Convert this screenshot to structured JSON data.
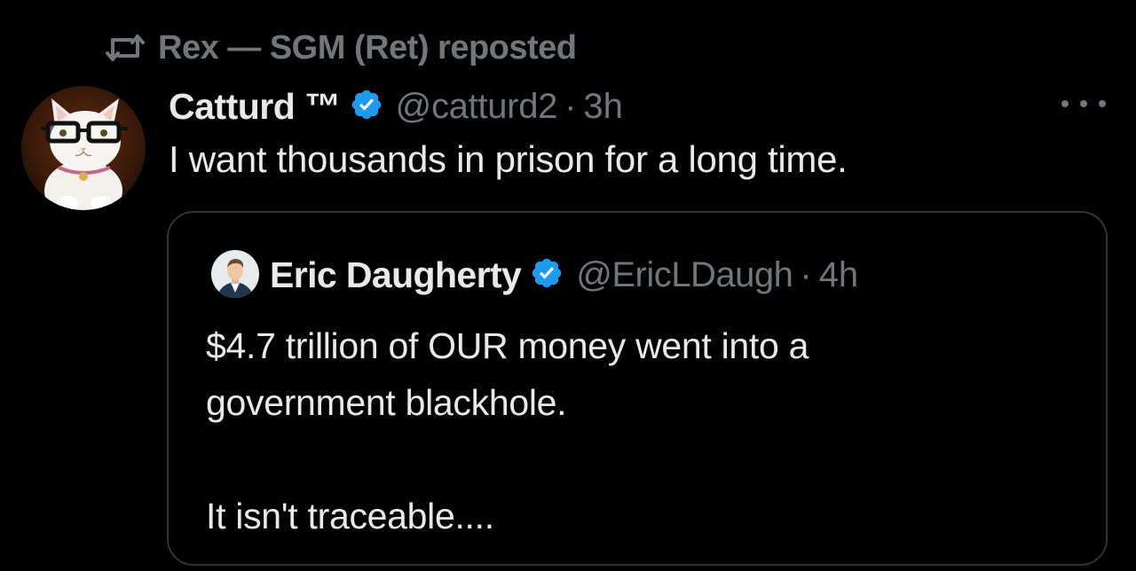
{
  "repost": {
    "text": "Rex — SGM (Ret) reposted",
    "icon": "repost-icon"
  },
  "tweet": {
    "author_name": "Catturd ™",
    "handle": "@catturd2",
    "separator": "·",
    "time": "3h",
    "text": "I want thousands in prison for a long time.",
    "verified_icon": "verified-badge-icon",
    "more_icon": "more-options-icon"
  },
  "quote": {
    "author_name": "Eric Daugherty",
    "handle": "@EricLDaugh",
    "separator": "·",
    "time": "4h",
    "verified_icon": "verified-badge-icon",
    "lines": [
      "$4.7 trillion of OUR money went into a",
      "government blackhole.",
      "",
      "It isn't traceable...."
    ]
  },
  "colors": {
    "background": "#000000",
    "primary_text": "#e7e9ea",
    "secondary_text": "#71767b",
    "border": "#2f3336",
    "verified_blue": "#1d9bf0"
  }
}
